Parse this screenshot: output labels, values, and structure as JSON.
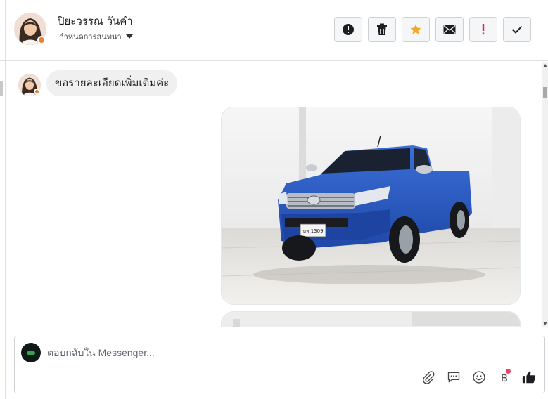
{
  "header": {
    "contact_name": "ปิยะวรรณ วันคำ",
    "conversation_menu_label": "กำหนดการสนทนา",
    "toolbar": [
      {
        "name": "report-spam",
        "icon": "exclamation-circle-icon"
      },
      {
        "name": "delete",
        "icon": "trash-icon"
      },
      {
        "name": "star",
        "icon": "star-icon",
        "color": "#f5a623"
      },
      {
        "name": "mark-unread",
        "icon": "envelope-icon"
      },
      {
        "name": "follow-up",
        "icon": "exclamation-icon",
        "color": "#e41e3f"
      },
      {
        "name": "mark-done",
        "icon": "checkmark-icon"
      }
    ]
  },
  "thread": {
    "messages": [
      {
        "from": "contact",
        "text": "ขอรายละเอียดเพิ่มเติมค่ะ"
      },
      {
        "from": "page",
        "type": "image",
        "description": "blue-pickup-truck-photo",
        "plate_text": "บห 1309"
      },
      {
        "from": "page",
        "type": "image",
        "description": "partial-photo"
      }
    ]
  },
  "composer": {
    "placeholder": "ตอบกลับใน Messenger...",
    "icons": [
      "paperclip-icon",
      "saved-reply-icon",
      "emoji-icon",
      "baht-payment-icon",
      "thumbs-up-icon"
    ],
    "accent": "#1877f2"
  }
}
